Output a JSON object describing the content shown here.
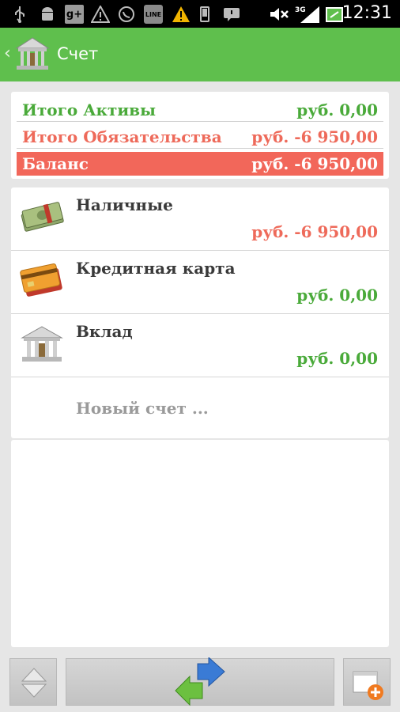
{
  "status_bar": {
    "time": "12:31",
    "network": "3G",
    "icons": [
      "usb-icon",
      "android-icon",
      "google-plus-icon",
      "warning-icon",
      "whatsapp-icon",
      "line-icon",
      "warning-yellow-icon",
      "phone-icon",
      "notification-icon",
      "mute-icon",
      "signal-icon",
      "battery-icon"
    ]
  },
  "appbar": {
    "title": "Счет"
  },
  "summary": {
    "assets_label": "Итого Активы",
    "assets_value": "руб. 0,00",
    "liabilities_label": "Итого Обязательства",
    "liabilities_value": "руб. -6 950,00",
    "balance_label": "Баланс",
    "balance_value": "руб. -6 950,00"
  },
  "accounts": [
    {
      "name": "Наличные",
      "amount": "руб. -6 950,00",
      "icon": "cash-icon",
      "negative": true
    },
    {
      "name": "Кредитная карта",
      "amount": "руб. 0,00",
      "icon": "credit-card-icon",
      "negative": false
    },
    {
      "name": "Вклад",
      "amount": "руб. 0,00",
      "icon": "bank-icon",
      "negative": false
    }
  ],
  "new_account_label": "Новый счет ...",
  "colors": {
    "accent": "#5fbf4d",
    "positive": "#4aaa3a",
    "negative": "#ee6a5a",
    "balance_bg": "#f2675a"
  }
}
